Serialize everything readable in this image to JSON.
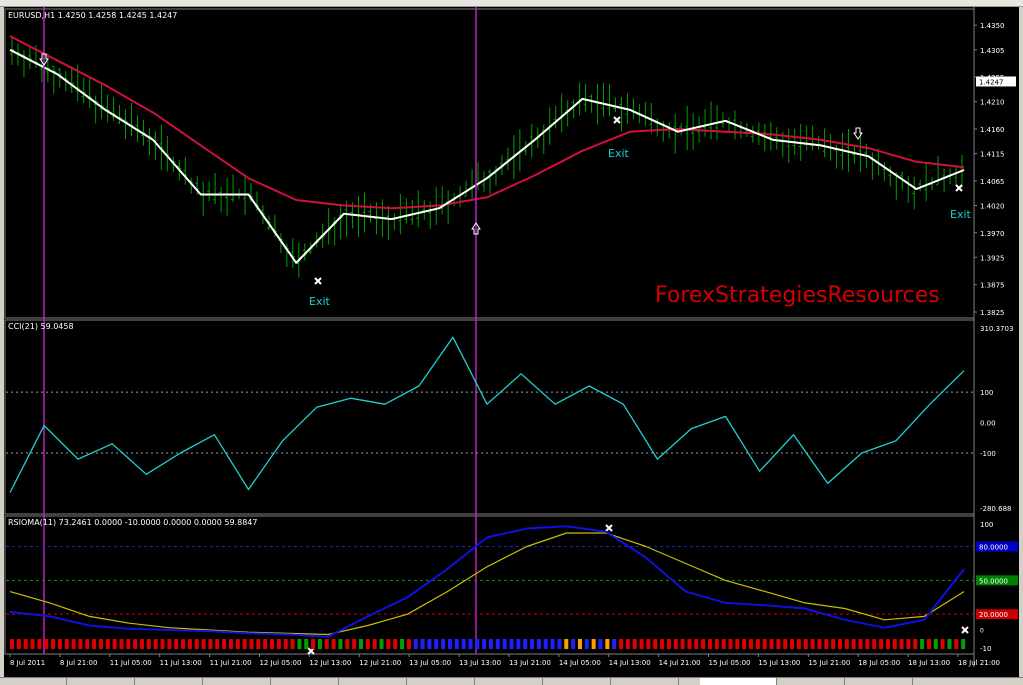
{
  "main_panel": {
    "label": "EURUSD,H1  1.4250 1.4258 1.4245 1.4247",
    "price_ticks": [
      "1.4350",
      "1.4305",
      "1.4255",
      "1.4210",
      "1.4160",
      "1.4115",
      "1.4065",
      "1.4020",
      "1.3970",
      "1.3925",
      "1.3875",
      "1.3825"
    ],
    "current_price": "1.4247",
    "exit_labels": [
      "Exit",
      "Exit",
      "Exit"
    ],
    "watermark": "ForexStrategiesResources"
  },
  "cci_panel": {
    "label": "CCI(21) 59.0458",
    "ticks": [
      "310.3703",
      "100",
      "0.00",
      "-100",
      "-280.688"
    ]
  },
  "rsioma_panel": {
    "label": "RSIOMA(11) 73.2461 0.0000 -10.0000 0.0000 0.0000 59.8847",
    "ticks": [
      "100",
      "80.0000",
      "50.0000",
      "20.0000",
      "-10"
    ],
    "badge_colors": {
      "80": "#0000c8",
      "50": "#008000",
      "20": "#c80000"
    }
  },
  "time_axis": [
    "8 Jul 2011",
    "8 Jul 21:00",
    "11 Jul 05:00",
    "11 Jul 13:00",
    "11 Jul 21:00",
    "12 Jul 05:00",
    "12 Jul 13:00",
    "12 Jul 21:00",
    "13 Jul 05:00",
    "13 Jul 13:00",
    "13 Jul 21:00",
    "14 Jul 05:00",
    "14 Jul 13:00",
    "14 Jul 21:00",
    "15 Jul 05:00",
    "15 Jul 13:00",
    "15 Jul 21:00",
    "18 Jul 05:00",
    "18 Jul 13:00",
    "18 Jul 21:00"
  ],
  "colors": {
    "background": "#000000",
    "bars": "#00a000",
    "fast_ma": "#ffffff",
    "slow_ma": "#d0103a",
    "cci": "#20d0d0",
    "rsioma": "#1010e0",
    "rsioma_signal": "#c8c000",
    "vline": "#c020c0",
    "watermark": "#d40000"
  },
  "chart_data": [
    {
      "type": "line",
      "title": "EURUSD,H1  1.4250 1.4258 1.4245 1.4247",
      "ylim": [
        1.3825,
        1.4365
      ],
      "x": [
        "8 Jul 2011",
        "8 Jul 21:00",
        "11 Jul 05:00",
        "11 Jul 13:00",
        "11 Jul 21:00",
        "12 Jul 05:00",
        "12 Jul 13:00",
        "12 Jul 21:00",
        "13 Jul 05:00",
        "13 Jul 13:00",
        "13 Jul 21:00",
        "14 Jul 05:00",
        "14 Jul 13:00",
        "14 Jul 21:00",
        "15 Jul 05:00",
        "15 Jul 13:00",
        "15 Jul 21:00",
        "18 Jul 05:00",
        "18 Jul 13:00",
        "18 Jul 21:00"
      ],
      "series": [
        {
          "values": [
            1.4305,
            1.426,
            1.4195,
            1.414,
            1.404,
            1.404,
            1.3915,
            1.4005,
            1.3995,
            1.4015,
            1.407,
            1.414,
            1.4215,
            1.4195,
            1.4155,
            1.4175,
            1.414,
            1.413,
            1.411,
            1.405,
            1.4085
          ]
        },
        {
          "values": [
            1.433,
            1.4285,
            1.424,
            1.419,
            1.413,
            1.407,
            1.403,
            1.402,
            1.4015,
            1.402,
            1.4035,
            1.4075,
            1.412,
            1.4155,
            1.416,
            1.4155,
            1.415,
            1.414,
            1.4125,
            1.41,
            1.409
          ]
        }
      ]
    },
    {
      "type": "line",
      "title": "CCI(21) 59.0458",
      "ylim": [
        -280.688,
        310.3703
      ],
      "x": [
        "8 Jul 2011",
        "8 Jul 21:00",
        "11 Jul 05:00",
        "11 Jul 13:00",
        "11 Jul 21:00",
        "12 Jul 05:00",
        "12 Jul 13:00",
        "12 Jul 21:00",
        "13 Jul 05:00",
        "13 Jul 13:00",
        "13 Jul 21:00",
        "14 Jul 05:00",
        "14 Jul 13:00",
        "14 Jul 21:00",
        "15 Jul 05:00",
        "15 Jul 13:00",
        "15 Jul 21:00",
        "18 Jul 05:00",
        "18 Jul 13:00",
        "18 Jul 21:00"
      ],
      "series": [
        {
          "values": [
            -230,
            -10,
            -120,
            -70,
            -170,
            -100,
            -40,
            -220,
            -60,
            50,
            80,
            60,
            120,
            280,
            60,
            160,
            60,
            120,
            60,
            -120,
            -20,
            20,
            -160,
            -40,
            -200,
            -100,
            -60,
            60,
            170
          ]
        }
      ]
    },
    {
      "type": "line",
      "title": "RSIOMA(11) 73.2461 0.0000 -10.0000 0.0000 0.0000 59.8847",
      "ylim": [
        -10,
        100
      ],
      "x": [
        "8 Jul 2011",
        "8 Jul 21:00",
        "11 Jul 05:00",
        "11 Jul 13:00",
        "11 Jul 21:00",
        "12 Jul 05:00",
        "12 Jul 13:00",
        "12 Jul 21:00",
        "13 Jul 05:00",
        "13 Jul 13:00",
        "13 Jul 21:00",
        "14 Jul 05:00",
        "14 Jul 13:00",
        "14 Jul 21:00",
        "15 Jul 05:00",
        "15 Jul 13:00",
        "15 Jul 21:00",
        "18 Jul 05:00",
        "18 Jul 13:00",
        "18 Jul 21:00"
      ],
      "series": [
        {
          "values": [
            22,
            18,
            10,
            7,
            6,
            5,
            3,
            2,
            0,
            18,
            35,
            60,
            88,
            96,
            98,
            93,
            70,
            40,
            30,
            28,
            25,
            15,
            8,
            15,
            60
          ]
        },
        {
          "values": [
            40,
            30,
            18,
            12,
            8,
            6,
            4,
            3,
            2,
            10,
            20,
            40,
            62,
            80,
            92,
            92,
            80,
            65,
            50,
            40,
            30,
            25,
            15,
            18,
            40
          ]
        }
      ]
    }
  ]
}
